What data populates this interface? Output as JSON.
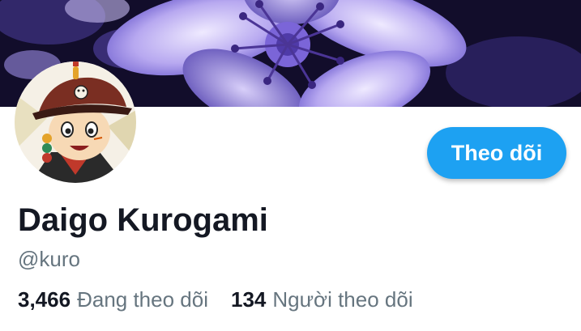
{
  "profile": {
    "display_name": "Daigo Kurogami",
    "handle": "@kuro",
    "follow_label": "Theo dõi",
    "following": {
      "count": "3,466",
      "label": "Đang theo dõi"
    },
    "followers": {
      "count": "134",
      "label": "Người theo dõi"
    }
  },
  "colors": {
    "accent": "#1da1f2",
    "banner_purple": "#6a5acd"
  },
  "icons": {
    "banner": "purple-flower-image",
    "avatar": "cartoon-character-avatar"
  }
}
